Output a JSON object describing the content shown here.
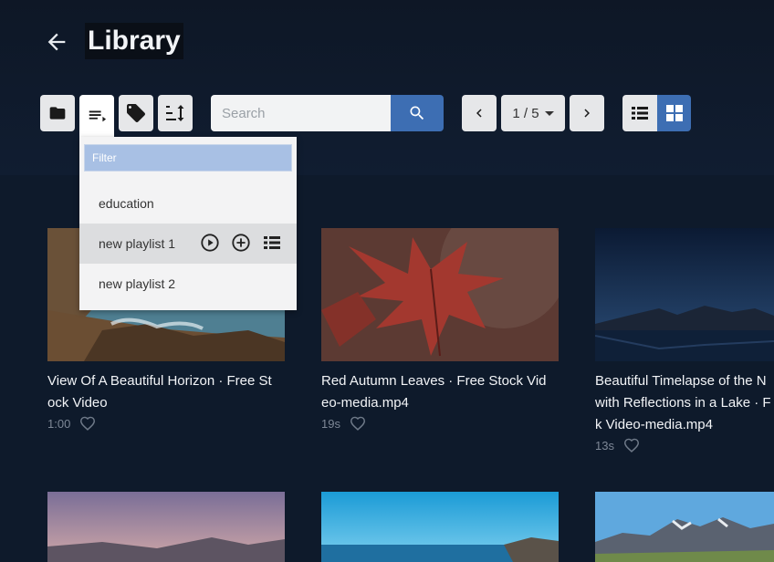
{
  "header": {
    "title": "Library",
    "back_icon": "arrow-left-icon"
  },
  "toolbar": {
    "buttons": [
      "folder-icon",
      "playlist-icon",
      "tag-icon",
      "sort-icon"
    ],
    "search": {
      "placeholder": "Search",
      "value": ""
    },
    "pagination": {
      "current": "1 / 5"
    },
    "view_modes": [
      "list-view-icon",
      "grid-view-icon"
    ],
    "active_view": "grid"
  },
  "playlist_dropdown": {
    "filter_placeholder": "Filter",
    "items": [
      {
        "label": "education"
      },
      {
        "label": "new playlist 1"
      },
      {
        "label": "new playlist 2"
      }
    ],
    "item_actions": [
      "play-circle-icon",
      "add-circle-icon",
      "list-icon"
    ]
  },
  "videos": [
    {
      "title": "View Of A Beautiful Horizon · Free Stock Video",
      "title_lines": [
        "View Of A Beautiful Horizon · Free St",
        "ock Video"
      ],
      "duration": "1:00"
    },
    {
      "title": "Red Autumn Leaves · Free Stock Video-media.mp4",
      "title_lines": [
        "Red Autumn Leaves · Free Stock Vid",
        "eo-media.mp4"
      ],
      "duration": "19s"
    },
    {
      "title": "Beautiful Timelapse of the N... with Reflections in a Lake · F... k Video-media.mp4",
      "title_lines": [
        "Beautiful Timelapse of the N",
        "with Reflections in a Lake · F",
        "k Video-media.mp4"
      ],
      "duration": "13s"
    }
  ],
  "colors": {
    "background": "#0e1a2b",
    "accent": "#3d6eb3",
    "button": "#e6e7e9"
  }
}
